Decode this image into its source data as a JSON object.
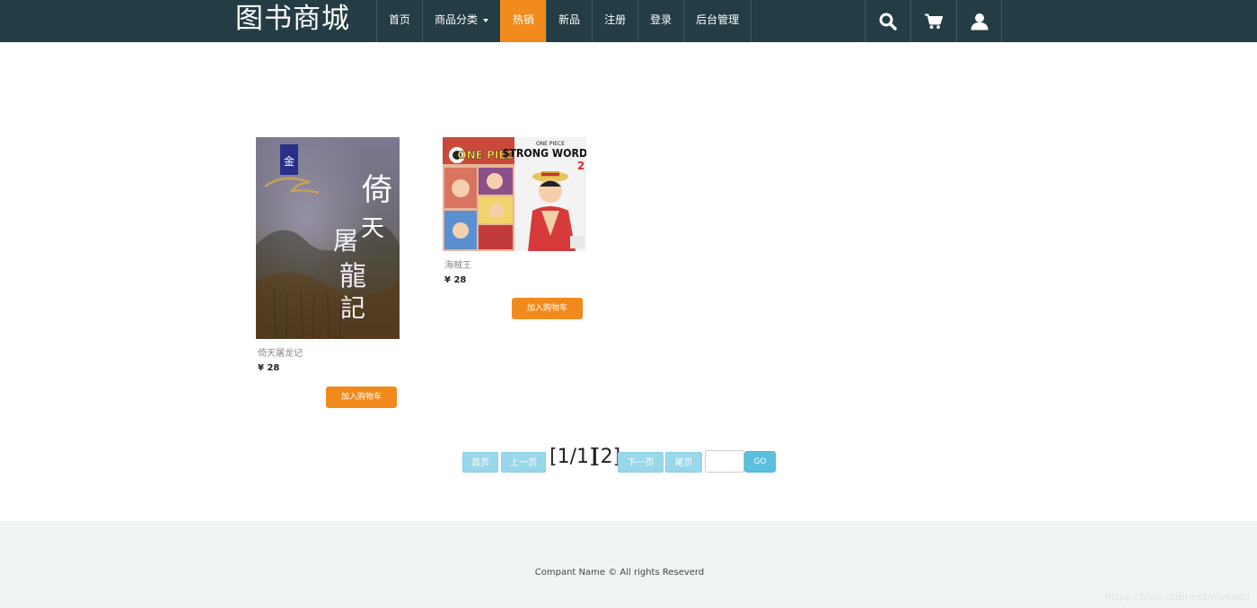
{
  "header": {
    "brand": "图书商城",
    "nav": [
      {
        "label": "首页"
      },
      {
        "label": "商品分类"
      },
      {
        "label": "热销"
      },
      {
        "label": "新品"
      },
      {
        "label": "注册"
      },
      {
        "label": "登录"
      },
      {
        "label": "后台管理"
      }
    ],
    "active_item": "热销",
    "icons": [
      "search-icon",
      "cart-icon",
      "user-icon"
    ],
    "colors": {
      "navbar": "#243c44",
      "accent": "#f08a1c"
    }
  },
  "products": [
    {
      "name": "倚天屠龙记",
      "price": "¥ 28",
      "button": "加入购物车",
      "cover_text": "倚天屠龍記",
      "cover_badge": "金庸"
    },
    {
      "name": "海贼王",
      "price": "¥ 28",
      "button": "加入购物车",
      "cover_title": "STRONG WORDS",
      "cover_series": "ONE PIECE",
      "cover_number": "2"
    }
  ],
  "pagination": {
    "first": "首页",
    "prev": "上一页",
    "current": "[1/1]",
    "page_link": "[2]",
    "next": "下一页",
    "last": "尾页",
    "go": "GO",
    "input_value": ""
  },
  "footer": {
    "copyright": "Compant Name © All rights Reseverd",
    "watermark": "https://blog.csdn.net/mysedu"
  }
}
